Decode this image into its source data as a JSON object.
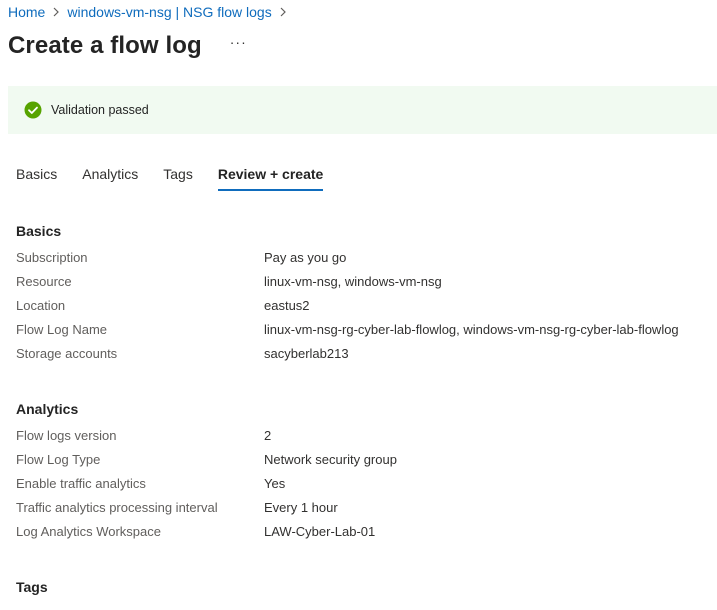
{
  "breadcrumb": {
    "items": [
      "Home",
      "windows-vm-nsg | NSG flow logs"
    ]
  },
  "header": {
    "title": "Create a flow log",
    "more": "···"
  },
  "validation": {
    "text": "Validation passed",
    "status_color": "#57a300"
  },
  "tabs": [
    {
      "label": "Basics",
      "active": false
    },
    {
      "label": "Analytics",
      "active": false
    },
    {
      "label": "Tags",
      "active": false
    },
    {
      "label": "Review + create",
      "active": true
    }
  ],
  "accent_color": "#0f6cbd",
  "sections": {
    "basics": {
      "heading": "Basics",
      "rows": [
        {
          "label": "Subscription",
          "value": "Pay as you go"
        },
        {
          "label": "Resource",
          "value": "linux-vm-nsg, windows-vm-nsg"
        },
        {
          "label": "Location",
          "value": "eastus2"
        },
        {
          "label": "Flow Log Name",
          "value": "linux-vm-nsg-rg-cyber-lab-flowlog, windows-vm-nsg-rg-cyber-lab-flowlog"
        },
        {
          "label": "Storage accounts",
          "value": "sacyberlab213"
        }
      ]
    },
    "analytics": {
      "heading": "Analytics",
      "rows": [
        {
          "label": "Flow logs version",
          "value": "2"
        },
        {
          "label": "Flow Log Type",
          "value": "Network security group"
        },
        {
          "label": "Enable traffic analytics",
          "value": "Yes"
        },
        {
          "label": "Traffic analytics processing interval",
          "value": "Every 1 hour"
        },
        {
          "label": "Log Analytics Workspace",
          "value": "LAW-Cyber-Lab-01"
        }
      ]
    },
    "tags": {
      "heading": "Tags"
    }
  }
}
